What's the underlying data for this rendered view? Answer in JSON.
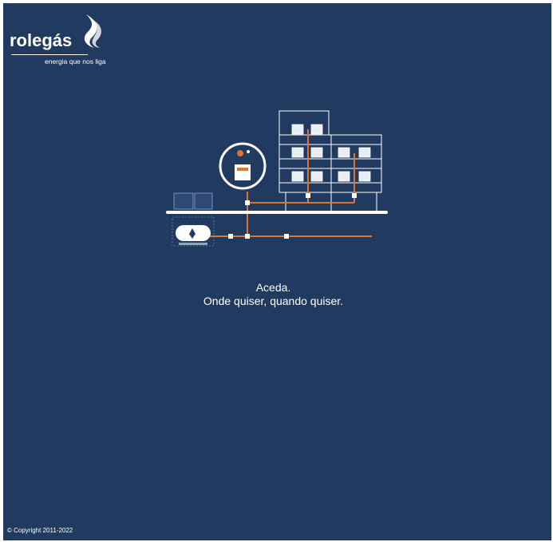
{
  "brand": {
    "name": "rolegás",
    "tagline": "energia que nos liga"
  },
  "colors": {
    "background": "#213a5f",
    "pipe": "#e0742e",
    "line": "#ffffff"
  },
  "hero": {
    "line1": "Aceda.",
    "line2": "Onde quiser, quando quiser."
  },
  "footer": {
    "copyright": "© Copyright 2011-2022"
  },
  "icons": {
    "logo_mark": "flame-icon",
    "illustration": "gas-network-illustration"
  }
}
